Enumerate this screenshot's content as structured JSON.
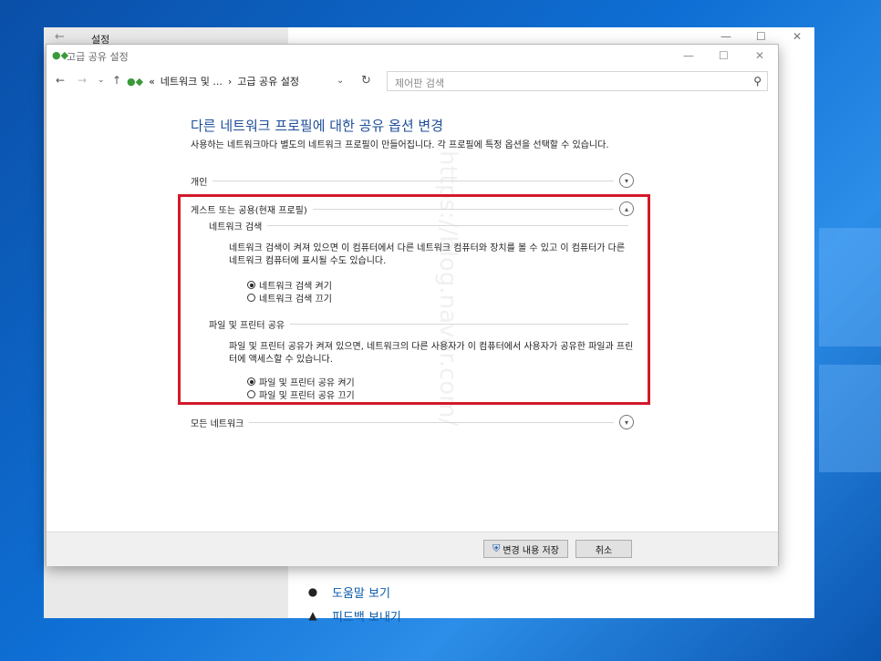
{
  "settings": {
    "title": "설정",
    "help_link": "도움말 보기",
    "feedback_link": "피드백 보내기"
  },
  "window": {
    "title": "고급 공유 설정"
  },
  "address": {
    "crumbs": [
      "«",
      "네트워크 및 ...",
      "›",
      "고급 공유 설정"
    ],
    "search_placeholder": "제어판 검색"
  },
  "page": {
    "title": "다른 네트워크 프로필에 대한 공유 옵션 변경",
    "description": "사용하는 네트워크마다 별도의 네트워크 프로필이 만들어집니다. 각 프로필에 특정 옵션을 선택할 수 있습니다."
  },
  "sections": {
    "private": "개인",
    "guest": "게스트 또는 공용(현재 프로필)",
    "all": "모든 네트워크"
  },
  "network_discovery": {
    "heading": "네트워크 검색",
    "text": "네트워크 검색이 켜져 있으면 이 컴퓨터에서 다른 네트워크 컴퓨터와 장치를 볼 수 있고 이 컴퓨터가 다른 네트워크 컴퓨터에 표시될 수도 있습니다.",
    "on_label": "네트워크 검색 켜기",
    "off_label": "네트워크 검색 끄기",
    "selected": "on"
  },
  "file_sharing": {
    "heading": "파일 및 프린터 공유",
    "text": "파일 및 프린터 공유가 켜져 있으면, 네트워크의 다른 사용자가 이 컴퓨터에서 사용자가 공유한 파일과 프린터에 액세스할 수 있습니다.",
    "on_label": "파일 및 프린터 공유 켜기",
    "off_label": "파일 및 프린터 공유 끄기",
    "selected": "on"
  },
  "buttons": {
    "save": "변경 내용 저장",
    "cancel": "취소"
  },
  "watermark": "https://blog.naver.com/",
  "colors": {
    "title_blue": "#1f4e99",
    "highlight_red": "#d21a2a",
    "link_blue": "#0b5aa8"
  }
}
